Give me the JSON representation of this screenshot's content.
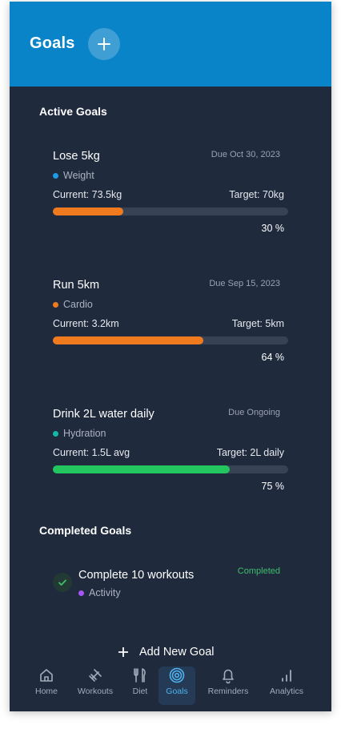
{
  "header": {
    "title": "Goals"
  },
  "active_section": {
    "title": "Active Goals"
  },
  "active_goals": [
    {
      "name": "Lose 5kg",
      "due": "Due  Oct 30, 2023",
      "category": "Weight",
      "category_color": "#1e9be6",
      "current": "Current:   73.5kg",
      "target": "Target:   70kg",
      "progress": 0.3,
      "percent": "30 %",
      "bar_color": "#f07a1e"
    },
    {
      "name": "Run 5km",
      "due": "Due  Sep 15, 2023",
      "category": "Cardio",
      "category_color": "#f07a1e",
      "current": "Current:   3.2km",
      "target": "Target:   5km",
      "progress": 0.64,
      "percent": "64 %",
      "bar_color": "#f07a1e"
    },
    {
      "name": "Drink 2L water daily",
      "due": "Due  Ongoing",
      "category": "Hydration",
      "category_color": "#14b8a6",
      "current": "Current:   1.5L avg",
      "target": "Target:   2L daily",
      "progress": 0.75,
      "percent": "75 %",
      "bar_color": "#22c55e"
    }
  ],
  "completed_section": {
    "title": "Completed Goals"
  },
  "completed_goals": [
    {
      "name": "Complete 10 workouts",
      "status": "Completed",
      "category": "Activity",
      "category_color": "#a855f7"
    }
  ],
  "add_goal_label": "Add New Goal",
  "nav": [
    {
      "label": "Home",
      "icon": "home-icon"
    },
    {
      "label": "Workouts",
      "icon": "dumbbell-icon"
    },
    {
      "label": "Diet",
      "icon": "fork-knife-icon"
    },
    {
      "label": "Goals",
      "icon": "target-icon",
      "active": true
    },
    {
      "label": "Reminders",
      "icon": "bell-icon"
    },
    {
      "label": "Analytics",
      "icon": "bar-chart-icon"
    }
  ]
}
